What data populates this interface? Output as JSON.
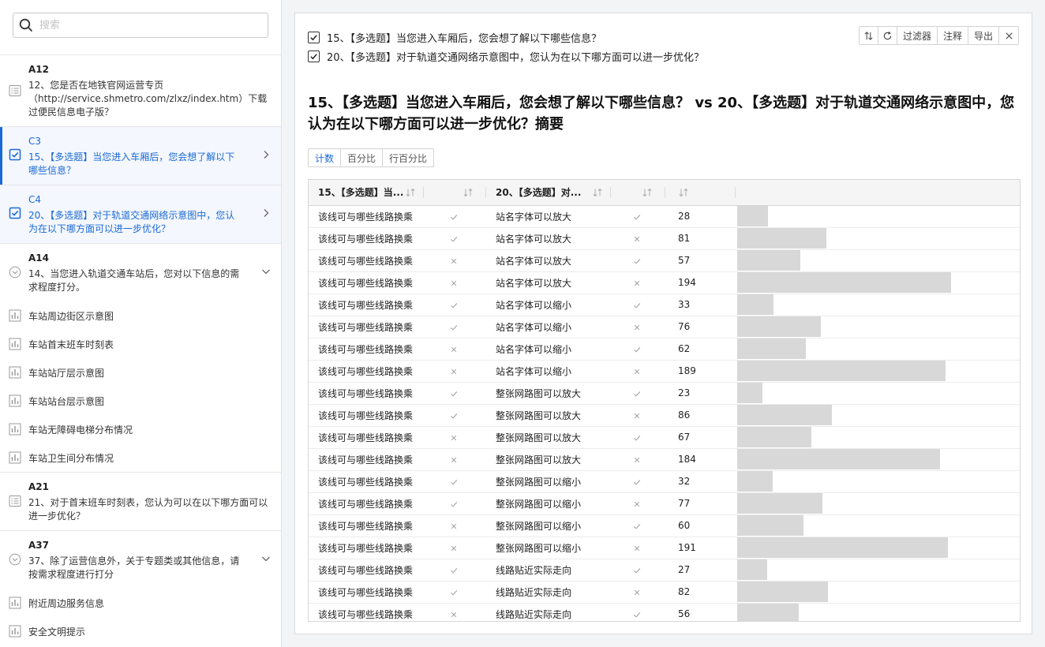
{
  "search": {
    "placeholder": "搜索"
  },
  "sidebar": {
    "groups": [
      {
        "code": "A12",
        "text": "12、您是否在地铁官网运营专页（http://service.shmetro.com/zlxz/index.htm）下载过便民信息电子版？",
        "icon": "list-icon"
      },
      {
        "code": "C3",
        "text": "15、【多选题】当您进入车厢后，您会想了解以下哪些信息？",
        "icon": "checkbox-icon",
        "trail": "chevron-right-icon"
      },
      {
        "code": "C4",
        "text": "20、【多选题】对于轨道交通网络示意图中，您认为在以下哪方面可以进一步优化？",
        "icon": "checkbox-icon",
        "trail": "chevron-right-icon"
      },
      {
        "code": "A14",
        "text": "14、当您进入轨道交通车站后，您对以下信息的需求程度打分。",
        "icon": "circle-chevron-icon",
        "trail": "chevron-down-icon"
      },
      {
        "code": "A21",
        "text": "21、对于首末班车时刻表，您认为可以在以下哪方面可以进一步优化？",
        "icon": "list-icon"
      },
      {
        "code": "A37",
        "text": "37、除了运营信息外，关于专题类或其他信息，请按需求程度进行打分",
        "icon": "circle-chevron-icon",
        "trail": "chevron-down-icon"
      }
    ],
    "a14_items": [
      "车站周边街区示意图",
      "车站首末班车时刻表",
      "车站站厅层示意图",
      "车站站台层示意图",
      "车站无障碍电梯分布情况",
      "车站卫生间分布情况"
    ],
    "a37_items": [
      "附近周边服务信息",
      "安全文明提示"
    ]
  },
  "main": {
    "questions": [
      "15、【多选题】当您进入车厢后，您会想了解以下哪些信息？",
      "20、【多选题】对于轨道交通网络示意图中，您认为在以下哪方面可以进一步优化？"
    ],
    "toolbar": {
      "filter": "过滤器",
      "annotate": "注释",
      "export": "导出"
    },
    "summary_title": "15、【多选题】当您进入车厢后，您会想了解以下哪些信息？ vs 20、【多选题】对于轨道交通网络示意图中，您认为在以下哪方面可以进一步优化？摘要",
    "modes": [
      "计数",
      "百分比",
      "行百分比"
    ],
    "table": {
      "headers": [
        "15、【多选题】当...",
        "",
        "20、【多选题】对...",
        "",
        "",
        ""
      ],
      "rows": [
        {
          "a": "该线可与哪些线路换乘",
          "am": "check",
          "b": "站名字体可以放大",
          "bm": "check",
          "n": 28
        },
        {
          "a": "该线可与哪些线路换乘",
          "am": "check",
          "b": "站名字体可以放大",
          "bm": "cross",
          "n": 81
        },
        {
          "a": "该线可与哪些线路换乘",
          "am": "cross",
          "b": "站名字体可以放大",
          "bm": "check",
          "n": 57
        },
        {
          "a": "该线可与哪些线路换乘",
          "am": "cross",
          "b": "站名字体可以放大",
          "bm": "cross",
          "n": 194
        },
        {
          "a": "该线可与哪些线路换乘",
          "am": "check",
          "b": "站名字体可以缩小",
          "bm": "check",
          "n": 33
        },
        {
          "a": "该线可与哪些线路换乘",
          "am": "check",
          "b": "站名字体可以缩小",
          "bm": "cross",
          "n": 76
        },
        {
          "a": "该线可与哪些线路换乘",
          "am": "cross",
          "b": "站名字体可以缩小",
          "bm": "check",
          "n": 62
        },
        {
          "a": "该线可与哪些线路换乘",
          "am": "cross",
          "b": "站名字体可以缩小",
          "bm": "cross",
          "n": 189
        },
        {
          "a": "该线可与哪些线路换乘",
          "am": "check",
          "b": "整张网路图可以放大",
          "bm": "check",
          "n": 23
        },
        {
          "a": "该线可与哪些线路换乘",
          "am": "check",
          "b": "整张网路图可以放大",
          "bm": "cross",
          "n": 86
        },
        {
          "a": "该线可与哪些线路换乘",
          "am": "cross",
          "b": "整张网路图可以放大",
          "bm": "check",
          "n": 67
        },
        {
          "a": "该线可与哪些线路换乘",
          "am": "cross",
          "b": "整张网路图可以放大",
          "bm": "cross",
          "n": 184
        },
        {
          "a": "该线可与哪些线路换乘",
          "am": "check",
          "b": "整张网路图可以缩小",
          "bm": "check",
          "n": 32
        },
        {
          "a": "该线可与哪些线路换乘",
          "am": "check",
          "b": "整张网路图可以缩小",
          "bm": "cross",
          "n": 77
        },
        {
          "a": "该线可与哪些线路换乘",
          "am": "cross",
          "b": "整张网路图可以缩小",
          "bm": "check",
          "n": 60
        },
        {
          "a": "该线可与哪些线路换乘",
          "am": "cross",
          "b": "整张网路图可以缩小",
          "bm": "cross",
          "n": 191
        },
        {
          "a": "该线可与哪些线路换乘",
          "am": "check",
          "b": "线路贴近实际走向",
          "bm": "check",
          "n": 27
        },
        {
          "a": "该线可与哪些线路换乘",
          "am": "check",
          "b": "线路贴近实际走向",
          "bm": "cross",
          "n": 82
        },
        {
          "a": "该线可与哪些线路换乘",
          "am": "cross",
          "b": "线路贴近实际走向",
          "bm": "check",
          "n": 56
        }
      ],
      "bar_scale_max": 211
    }
  },
  "colors": {
    "accent": "#1a6ad6",
    "bar": "#d8d8d8",
    "selected_bg": "#f4f7fd"
  }
}
